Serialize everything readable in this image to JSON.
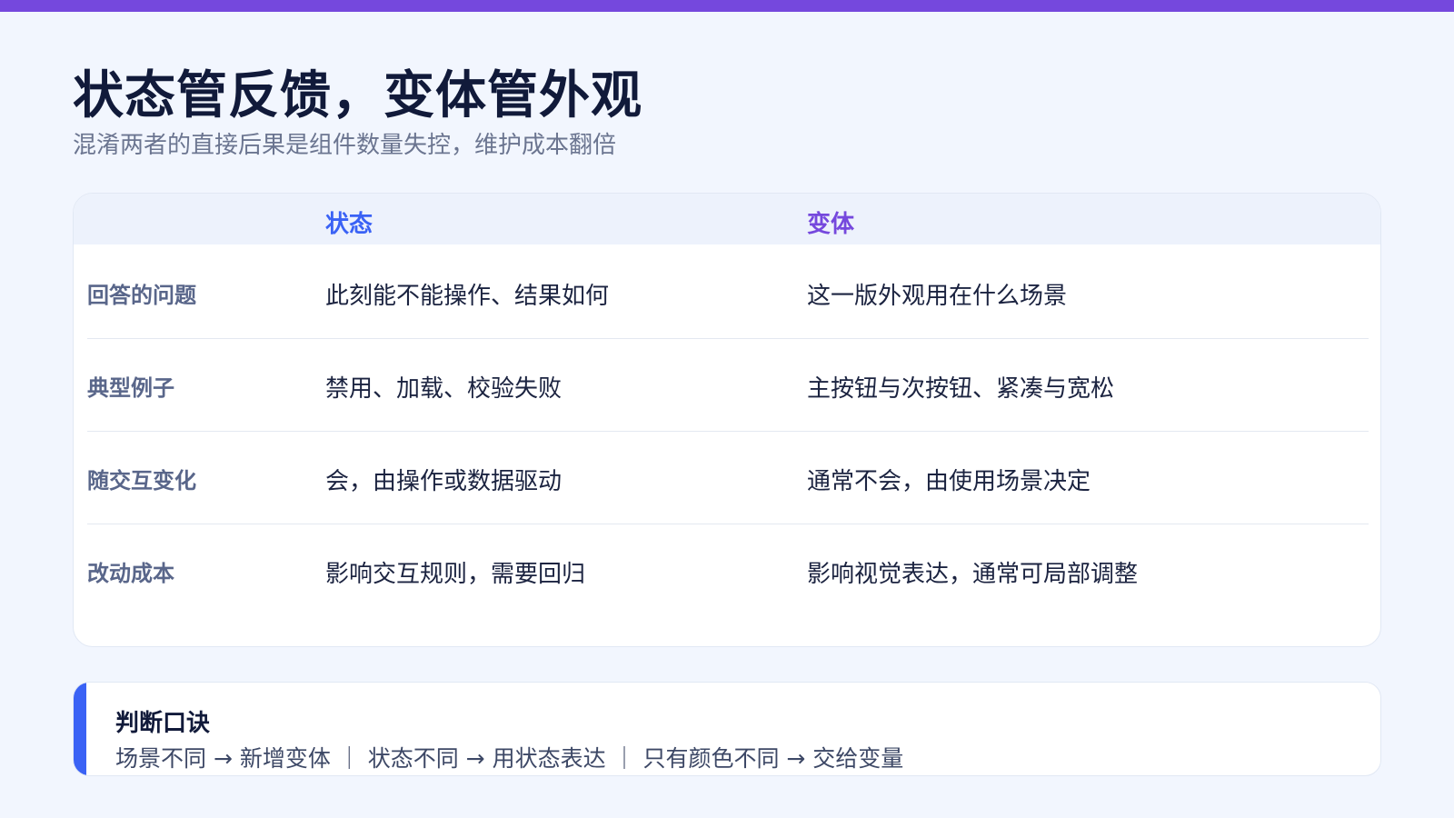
{
  "header": {
    "title": "状态管反馈，变体管外观",
    "subtitle": "混淆两者的直接后果是组件数量失控，维护成本翻倍"
  },
  "table": {
    "columns": {
      "state": "状态",
      "variant": "变体"
    },
    "rows": [
      {
        "label": "回答的问题",
        "state": "此刻能不能操作、结果如何",
        "variant": "这一版外观用在什么场景"
      },
      {
        "label": "典型例子",
        "state": "禁用、加载、校验失败",
        "variant": "主按钮与次按钮、紧凑与宽松"
      },
      {
        "label": "随交互变化",
        "state": "会，由操作或数据驱动",
        "variant": "通常不会，由使用场景决定"
      },
      {
        "label": "改动成本",
        "state": "影响交互规则，需要回归",
        "variant": "影响视觉表达，通常可局部调整"
      }
    ]
  },
  "tip": {
    "title": "判断口诀",
    "body": "场景不同 → 新增变体 ｜ 状态不同 → 用状态表达 ｜ 只有颜色不同 → 交给变量"
  },
  "colors": {
    "top_bar": "#7548dd",
    "state_heading": "#3a62f5",
    "variant_heading": "#7548dd",
    "tip_accent": "#3a62f5"
  }
}
